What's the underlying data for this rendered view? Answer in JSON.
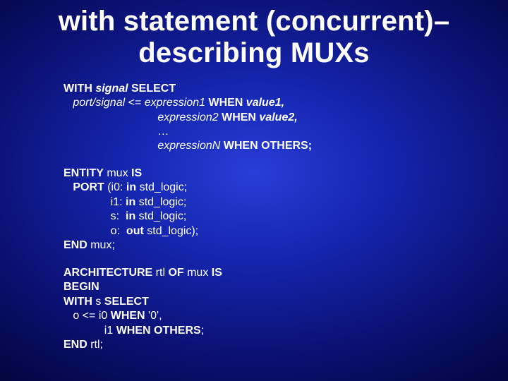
{
  "title": "with statement (concurrent)– describing MUXs",
  "syntax": {
    "l1a": "WITH ",
    "l1b": "signal",
    "l1c": " SELECT",
    "l2a": "   port/signal",
    "l2b": " <= ",
    "l2c": "expression1",
    "l2d": " WHEN ",
    "l2e": "value1,",
    "l3a": "                              ",
    "l3b": "expression2",
    "l3c": " WHEN ",
    "l3d": "value2,",
    "l4": "                              …",
    "l5a": "                              ",
    "l5b": "expressionN",
    "l5c": " WHEN OTHERS;"
  },
  "entity": {
    "l1a": "ENTITY",
    "l1b": " mux ",
    "l1c": "IS",
    "l2a": "   PORT",
    "l2b": " (i0: ",
    "l2c": "in",
    "l2d": " std_logic;",
    "l3a": "               i1: ",
    "l3b": "in",
    "l3c": " std_logic;",
    "l4a": "               s:  ",
    "l4b": "in",
    "l4c": " std_logic;",
    "l5a": "               o:  ",
    "l5b": "out",
    "l5c": " std_logic);",
    "l6a": "END",
    "l6b": " mux;"
  },
  "arch": {
    "l1a": "ARCHITECTURE",
    "l1b": " rtl ",
    "l1c": "OF",
    "l1d": " mux ",
    "l1e": "IS",
    "l2": "BEGIN",
    "l3a": "WITH",
    "l3b": " s ",
    "l3c": "SELECT",
    "l4a": "   o <= i0 ",
    "l4b": "WHEN",
    "l4c": " '0',",
    "l5a": "             i1 ",
    "l5b": "WHEN OTHERS",
    "l5c": ";",
    "l6a": "END",
    "l6b": " rtl;"
  }
}
